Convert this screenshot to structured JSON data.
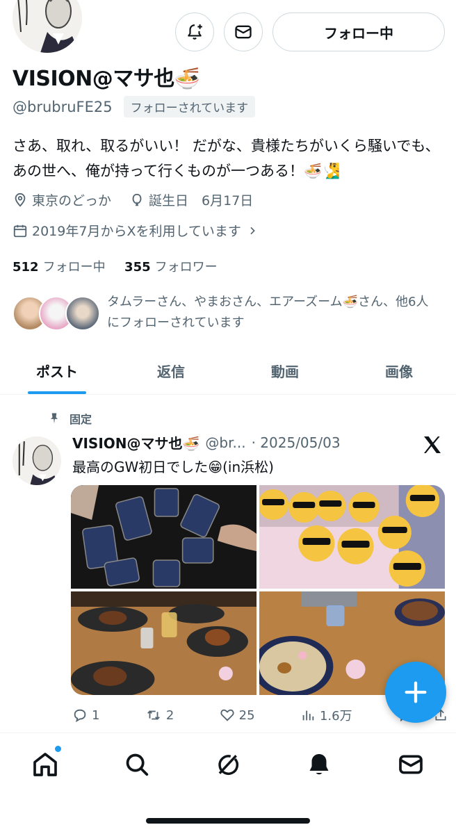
{
  "profile": {
    "display_name": "VISION@マサ也🍜",
    "handle": "@brubruFE25",
    "follows_you": "フォローされています",
    "follow_button": "フォロー中",
    "bio": "さあ、取れ、取るがいい！ だがな、貴様たちがいくら騒いでも、あの世へ、俺が持って行くものが一つある！🍜🧏‍♂️",
    "location": "東京のどっか",
    "birthday": "誕生日　6月17日",
    "joined": "2019年7月からXを利用しています",
    "following_count": "512",
    "following_label": "フォロー中",
    "followers_count": "355",
    "followers_label": "フォロワー",
    "mutuals_text": "タムラーさん、やまおさん、エアーズーム🍜さん、他6人にフォローされています"
  },
  "tabs": [
    {
      "label": "ポスト",
      "active": true
    },
    {
      "label": "返信",
      "active": false
    },
    {
      "label": "動画",
      "active": false
    },
    {
      "label": "画像",
      "active": false
    }
  ],
  "post": {
    "pinned_label": "固定",
    "author_name": "VISION@マサ也🍜",
    "author_handle": "@br...",
    "date": "· 2025/05/03",
    "text": "最高のGW初日でした😁(in浜松)",
    "replies": "1",
    "reposts": "2",
    "likes": "25",
    "views": "1.6万"
  },
  "colors": {
    "accent": "#1d9bf0",
    "secondary_text": "#536471",
    "border": "#cfd9de"
  },
  "icons": {
    "notify": "bell-plus-icon",
    "message": "envelope-icon",
    "location": "location-pin-icon",
    "birthday": "balloon-icon",
    "calendar": "calendar-icon",
    "pin": "pin-icon",
    "x_logo": "x-logo-icon",
    "compose": "plus-icon",
    "nav": [
      "home-icon",
      "search-icon",
      "grok-icon",
      "bell-icon",
      "envelope-icon"
    ]
  }
}
